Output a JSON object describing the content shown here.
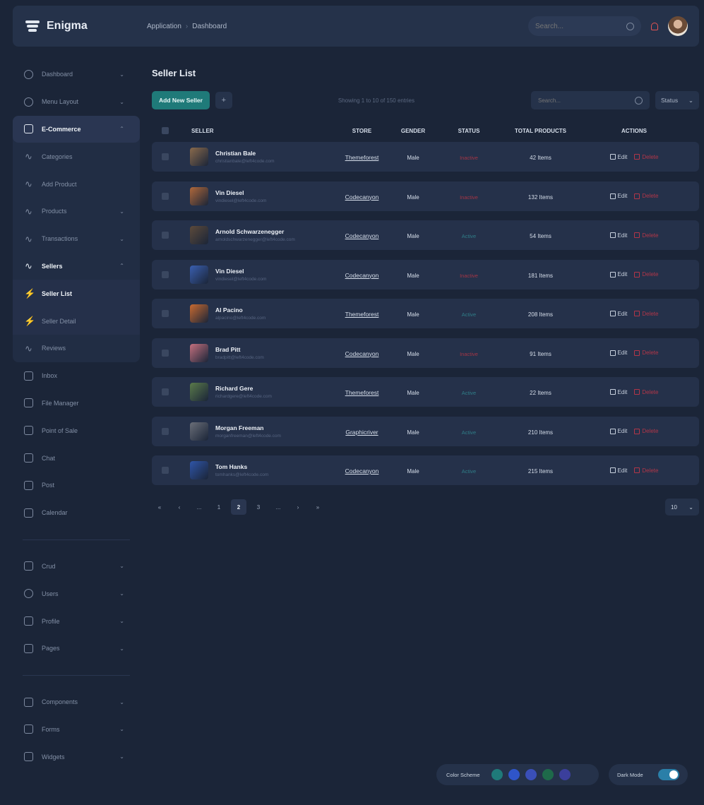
{
  "app": {
    "name": "Enigma"
  },
  "breadcrumb": [
    "Application",
    "Dashboard"
  ],
  "topbar": {
    "search_placeholder": "Search..."
  },
  "sidebar": {
    "items": [
      {
        "label": "Dashboard",
        "icon": "home-icon",
        "chevron": true
      },
      {
        "label": "Menu Layout",
        "icon": "box-icon",
        "chevron": true
      },
      {
        "label": "E-Commerce",
        "icon": "shopping-bag-icon",
        "chevron": true,
        "active": true
      },
      {
        "label": "Categories",
        "icon": "activity-icon"
      },
      {
        "label": "Add Product",
        "icon": "activity-icon"
      },
      {
        "label": "Products",
        "icon": "activity-icon",
        "chevron": true
      },
      {
        "label": "Transactions",
        "icon": "activity-icon",
        "chevron": true
      },
      {
        "label": "Sellers",
        "icon": "activity-icon",
        "chevron": true,
        "active": true
      },
      {
        "label": "Seller List",
        "icon": "zap-icon",
        "active": true
      },
      {
        "label": "Seller Detail",
        "icon": "zap-icon"
      },
      {
        "label": "Reviews",
        "icon": "activity-icon"
      },
      {
        "label": "Inbox",
        "icon": "inbox-icon"
      },
      {
        "label": "File Manager",
        "icon": "hard-drive-icon"
      },
      {
        "label": "Point of Sale",
        "icon": "credit-card-icon"
      },
      {
        "label": "Chat",
        "icon": "message-icon"
      },
      {
        "label": "Post",
        "icon": "file-text-icon"
      },
      {
        "label": "Calendar",
        "icon": "calendar-icon"
      }
    ],
    "group2": [
      {
        "label": "Crud",
        "icon": "edit-icon",
        "chevron": true
      },
      {
        "label": "Users",
        "icon": "users-icon",
        "chevron": true
      },
      {
        "label": "Profile",
        "icon": "trello-icon",
        "chevron": true
      },
      {
        "label": "Pages",
        "icon": "layout-icon",
        "chevron": true
      }
    ],
    "group3": [
      {
        "label": "Components",
        "icon": "inbox-icon",
        "chevron": true
      },
      {
        "label": "Forms",
        "icon": "sidebar-icon",
        "chevron": true
      },
      {
        "label": "Widgets",
        "icon": "hard-drive-icon",
        "chevron": true
      }
    ]
  },
  "page": {
    "title": "Seller List",
    "add_button": "Add New Seller",
    "plus": "+",
    "showing": "Showing 1 to 10 of 150 entries",
    "search_placeholder": "Search...",
    "status_filter": "Status"
  },
  "table": {
    "headers": {
      "seller": "Seller",
      "store": "Store",
      "gender": "Gender",
      "status": "Status",
      "total": "Total Products",
      "actions": "Actions"
    },
    "rows": [
      {
        "name": "Christian Bale",
        "email": "christianbale@left4code.com",
        "store": "Themeforest",
        "gender": "Male",
        "status": "Inactive",
        "active": false,
        "total": "42 Items",
        "photo": "#8a6a4c"
      },
      {
        "name": "Vin Diesel",
        "email": "vindiesel@left4code.com",
        "store": "Codecanyon",
        "gender": "Male",
        "status": "Inactive",
        "active": false,
        "total": "132 Items",
        "photo": "#b0683a"
      },
      {
        "name": "Arnold Schwarzenegger",
        "email": "arnoldschwarzenegger@left4code.com",
        "store": "Codecanyon",
        "gender": "Male",
        "status": "Active",
        "active": true,
        "total": "54 Items",
        "photo": "#5c4a3a"
      },
      {
        "name": "Vin Diesel",
        "email": "vindiesel@left4code.com",
        "store": "Codecanyon",
        "gender": "Male",
        "status": "Inactive",
        "active": false,
        "total": "181 Items",
        "photo": "#3a5fb0"
      },
      {
        "name": "Al Pacino",
        "email": "alpacino@left4code.com",
        "store": "Themeforest",
        "gender": "Male",
        "status": "Active",
        "active": true,
        "total": "208 Items",
        "photo": "#c96a30"
      },
      {
        "name": "Brad Pitt",
        "email": "bradpitt@left4code.com",
        "store": "Codecanyon",
        "gender": "Male",
        "status": "Inactive",
        "active": false,
        "total": "91 Items",
        "photo": "#c4707e"
      },
      {
        "name": "Richard Gere",
        "email": "richardgere@left4code.com",
        "store": "Themeforest",
        "gender": "Male",
        "status": "Active",
        "active": true,
        "total": "22 Items",
        "photo": "#5a7a4a"
      },
      {
        "name": "Morgan Freeman",
        "email": "morganfreeman@left4code.com",
        "store": "Graphicriver",
        "gender": "Male",
        "status": "Active",
        "active": true,
        "total": "210 Items",
        "photo": "#6a6e78"
      },
      {
        "name": "Tom Hanks",
        "email": "tomhanks@left4code.com",
        "store": "Codecanyon",
        "gender": "Male",
        "status": "Active",
        "active": true,
        "total": "215 Items",
        "photo": "#2f55a8"
      }
    ],
    "edit_label": "Edit",
    "delete_label": "Delete"
  },
  "pagination": {
    "pages": [
      "«",
      "‹",
      "...",
      "1",
      "2",
      "3",
      "...",
      "›",
      "»"
    ],
    "current": "2",
    "per_page": "10"
  },
  "theme": {
    "label": "Color Scheme",
    "swatches": [
      "#1f7a79",
      "#2f55c9",
      "#3a4fb8",
      "#1e6a4a",
      "#3b3f9c"
    ],
    "dark_label": "Dark Mode"
  }
}
